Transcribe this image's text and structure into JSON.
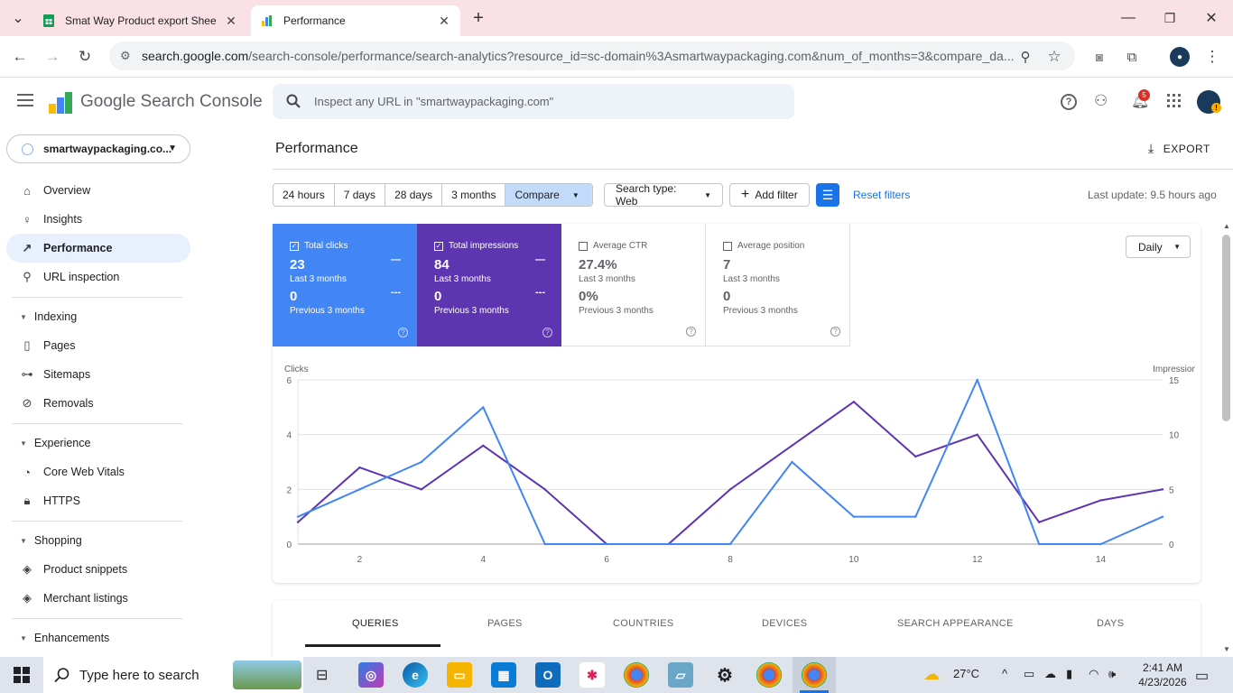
{
  "browser": {
    "tabs": [
      {
        "title": "Smat Way Product export Shee",
        "active": false
      },
      {
        "title": "Performance",
        "active": true
      }
    ],
    "url_host": "search.google.com",
    "url_rest": "/search-console/performance/search-analytics?resource_id=sc-domain%3Asmartwaypackaging.com&num_of_months=3&compare_da..."
  },
  "header": {
    "product": "Google Search Console",
    "search_placeholder": "Inspect any URL in \"smartwaypackaging.com\"",
    "notifications": "5"
  },
  "sidebar": {
    "property": "smartwaypackaging.co...",
    "items": [
      {
        "label": "Overview",
        "icon": "home-icon"
      },
      {
        "label": "Insights",
        "icon": "lightbulb-icon"
      },
      {
        "label": "Performance",
        "icon": "trending-icon",
        "active": true
      },
      {
        "label": "URL inspection",
        "icon": "search-icon"
      }
    ],
    "sections": [
      {
        "title": "Indexing",
        "items": [
          "Pages",
          "Sitemaps",
          "Removals"
        ]
      },
      {
        "title": "Experience",
        "items": [
          "Core Web Vitals",
          "HTTPS"
        ]
      },
      {
        "title": "Shopping",
        "items": [
          "Product snippets",
          "Merchant listings"
        ]
      },
      {
        "title": "Enhancements",
        "items": []
      }
    ]
  },
  "page": {
    "title": "Performance",
    "export_label": "EXPORT",
    "date_ranges": [
      "24 hours",
      "7 days",
      "28 days",
      "3 months",
      "Compare"
    ],
    "selected_range": "Compare",
    "search_type": "Search type: Web",
    "add_filter": "Add filter",
    "reset_filters": "Reset filters",
    "last_update": "Last update: 9.5 hours ago",
    "granularity": "Daily"
  },
  "metrics": [
    {
      "label": "Total clicks",
      "value": "23",
      "period": "Last 3 months",
      "prev_value": "0",
      "prev_period": "Previous 3 months",
      "checked": true,
      "color": "#4285f4"
    },
    {
      "label": "Total impressions",
      "value": "84",
      "period": "Last 3 months",
      "prev_value": "0",
      "prev_period": "Previous 3 months",
      "checked": true,
      "color": "#5e35b1"
    },
    {
      "label": "Average CTR",
      "value": "27.4%",
      "period": "Last 3 months",
      "prev_value": "0%",
      "prev_period": "Previous 3 months",
      "checked": false
    },
    {
      "label": "Average position",
      "value": "7",
      "period": "Last 3 months",
      "prev_value": "0",
      "prev_period": "Previous 3 months",
      "checked": false
    }
  ],
  "chart_data": {
    "type": "line",
    "ylabel_left": "Clicks",
    "ylabel_right": "Impressions",
    "x": [
      1,
      2,
      3,
      4,
      5,
      6,
      7,
      8,
      9,
      10,
      11,
      12,
      13,
      14,
      15
    ],
    "x_ticks": [
      "2",
      "4",
      "6",
      "8",
      "10",
      "12",
      "14"
    ],
    "y_left_ticks": [
      "0",
      "2",
      "4",
      "6"
    ],
    "y_right_ticks": [
      "0",
      "5",
      "10",
      "15"
    ],
    "ylim_left": [
      0,
      6
    ],
    "ylim_right": [
      0,
      15
    ],
    "series": [
      {
        "name": "Clicks",
        "axis": "left",
        "color": "#4285f4",
        "values": [
          1,
          2,
          3,
          5,
          0,
          0,
          0,
          0,
          3,
          1,
          1,
          6,
          0,
          0,
          1
        ]
      },
      {
        "name": "Impressions",
        "axis": "right",
        "color": "#5e35b1",
        "values": [
          2,
          7,
          5,
          9,
          5,
          0,
          0,
          5,
          9,
          13,
          8,
          10,
          2,
          4,
          5
        ]
      }
    ],
    "grid": true
  },
  "bottom_tabs": [
    "QUERIES",
    "PAGES",
    "COUNTRIES",
    "DEVICES",
    "SEARCH APPEARANCE",
    "DAYS"
  ],
  "taskbar": {
    "search_placeholder": "Type here to search",
    "weather": "27°C",
    "time": "2:41 AM",
    "date": "4/23/2026"
  }
}
